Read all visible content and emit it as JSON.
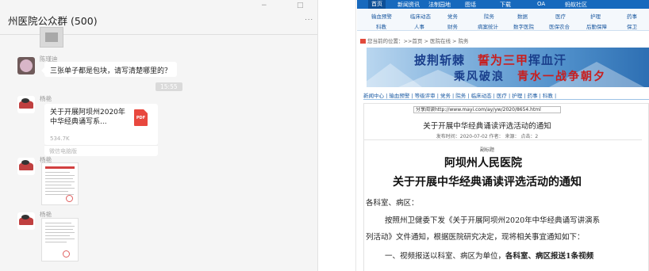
{
  "chat": {
    "title": "州医院公众群 (500)",
    "window_controls": {
      "minimize": "−",
      "maximize": "□"
    },
    "more": "...",
    "messages": [
      {
        "sender": "陈瑾迪",
        "text": "三张单子都是包块，请写清楚哪里的？"
      },
      {
        "sender": "杨艳"
      },
      {
        "sender": "杨艳"
      },
      {
        "sender": "杨艳"
      }
    ],
    "time": "15:55",
    "file": {
      "name": "关于开展阿坝州2020年中华经典诵写系...",
      "size": "534.7K",
      "footer": "微信电脑版",
      "type": "PDF"
    }
  },
  "web": {
    "top_nav": [
      "首页",
      "新闻资讯",
      "法制园地",
      "图话",
      "下载",
      "OA",
      "蚂蚁社区"
    ],
    "sub_nav_row1": [
      "输血预警",
      "临床动态",
      "党务",
      "院务",
      "数据",
      "医疗",
      "护理",
      "药事"
    ],
    "sub_nav_row2": [
      "科教",
      "人事",
      "财务",
      "病案统计",
      "数字医院",
      "医保农合",
      "后勤保障",
      "保卫"
    ],
    "breadcrumb": "您当前的位置：>>首页 > 医院在线 > 院务",
    "banner": {
      "line1_a": "披荆斩棘",
      "line1_b": "誓为三甲",
      "line1_c": "挥血汗",
      "line2_a": "乘风破浪",
      "line2_b": "青水一战争朝夕"
    },
    "category_bar": "新闻中心 | 输血预警 | 等级评审 | 党务 | 院务 | 临床动态 | 医疗 | 护理 | 药事 | 科教 |",
    "share": "分享阅读http://www.mayi.com/ay/yw/2020/8654.html",
    "article_title": "关于开展中华经典诵读评选活动的通知",
    "article_meta": "发布时间：2020-07-02 作者： 来源： 点击：2",
    "sub_label": "副标题",
    "hospital": "阿坝州人民医院",
    "notice_title": "关于开展中华经典诵读评选活动的通知",
    "salutation": "各科室、病区：",
    "para1_line1": "按照州卫健委下发《关于开展阿坝州2020年中华经典诵写讲演系",
    "para1_line2": "列活动》文件通知，根据医院研究决定，现将相关事宜通知如下：",
    "para2_prefix": "一、视频报送以科室、病区为单位，",
    "para2_bold": "各科室、病区报送1条视频"
  }
}
